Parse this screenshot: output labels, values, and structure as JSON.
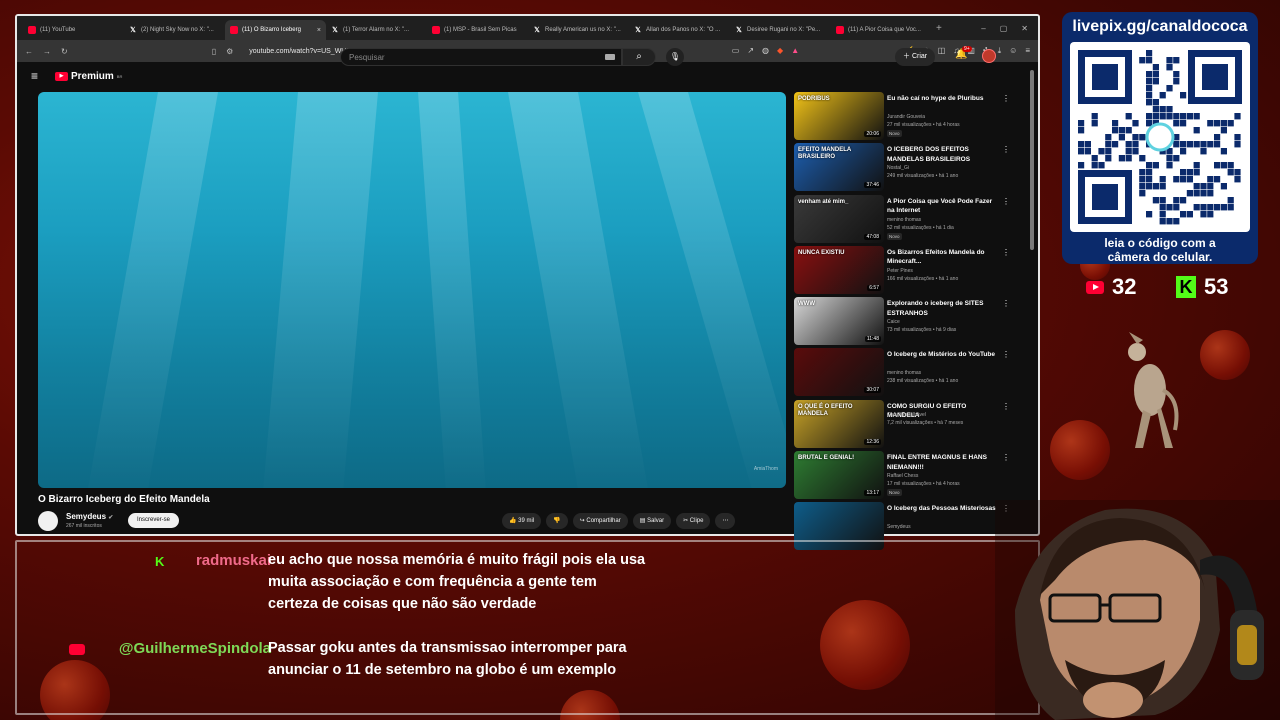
{
  "browser": {
    "tabs": [
      {
        "label": "(11) YouTube",
        "icon": "youtube-icon",
        "active": false
      },
      {
        "label": "(2) Night Sky Now no X: \"...",
        "icon": "x-icon",
        "active": false
      },
      {
        "label": "(11) O Bizarro Iceberg",
        "icon": "youtube-icon",
        "active": true
      },
      {
        "label": "(1) Terror Alarm no X: \"...",
        "icon": "x-icon",
        "active": false
      },
      {
        "label": "(1) MSP - Brasil Sem Picas",
        "icon": "youtube-icon",
        "active": false
      },
      {
        "label": "Really American us no X: \"...",
        "icon": "x-icon",
        "active": false
      },
      {
        "label": "Allan dos Panos no X: \"O ...",
        "icon": "x-icon",
        "active": false
      },
      {
        "label": "Desiree Rugani no X: \"Pe...",
        "icon": "x-icon",
        "active": false
      },
      {
        "label": "(11) A Pior Coisa que Voc...",
        "icon": "youtube-icon",
        "active": false
      }
    ],
    "url": "youtube.com/watch?v=US_WUEzBcOM"
  },
  "youtube": {
    "logo_text": "Premium",
    "logo_sup": "BR",
    "search_placeholder": "Pesquisar",
    "create_label": "Criar",
    "notif_count": "9+",
    "video": {
      "title": "O Bizarro Iceberg do Efeito Mandela",
      "channel": "Semydeus",
      "subscribers": "267 mil inscritos",
      "subscribe_label": "Inscrever-se",
      "likes": "39 mil",
      "share_label": "Compartilhar",
      "save_label": "Salvar",
      "clip_label": "Clipe",
      "watermark": "AmiaThom"
    },
    "recommendations": [
      {
        "title": "Eu não caí no hype de Pluribus",
        "channel": "Jurandir Gouveia",
        "meta": "27 mil visualizações • há 4 horas",
        "badge": "Novo",
        "duration": "20:06",
        "thumb_text": "PODRIBUS",
        "thumb_color": "#f2c318"
      },
      {
        "title": "O ICEBERG DOS EFEITOS MANDELAS BRASILEIROS",
        "channel": "Nostal_Gi",
        "meta": "249 mil visualizações • há 1 ano",
        "badge": "",
        "duration": "37:46",
        "thumb_text": "EFEITO MANDELA BRASILEIRO",
        "thumb_color": "#1d5fb0"
      },
      {
        "title": "A Pior Coisa que Você Pode Fazer na Internet",
        "channel": "menino thomas",
        "meta": "52 mil visualizações • há 1 dia",
        "badge": "Novo",
        "duration": "47:08",
        "thumb_text": "venham até mim_",
        "thumb_color": "#3a3a3a"
      },
      {
        "title": "Os Bizarros Efeitos Mandela do Minecraft...",
        "channel": "Peter Pines",
        "meta": "166 mil visualizações • há 1 ano",
        "badge": "",
        "duration": "6:57",
        "thumb_text": "NUNCA EXISTIU",
        "thumb_color": "#8a1010"
      },
      {
        "title": "Explorando o iceberg de SITES ESTRANHOS",
        "channel": "Caice",
        "meta": "73 mil visualizações • há 9 dias",
        "badge": "",
        "duration": "11:48",
        "thumb_text": "WWW",
        "thumb_color": "#d8d8d8"
      },
      {
        "title": "O Iceberg de Mistérios do YouTube",
        "channel": "menino thomas",
        "meta": "238 mil visualizações • há 1 ano",
        "badge": "",
        "duration": "30:07",
        "thumb_text": "",
        "thumb_color": "#5a0b0b"
      },
      {
        "title": "COMO SURGIU O EFEITO MANDELA",
        "channel": "Canal Espalhável",
        "meta": "7,2 mil visualizações • há 7 meses",
        "badge": "",
        "duration": "12:36",
        "thumb_text": "O QUE É O EFEITO MANDELA",
        "thumb_color": "#c7a227"
      },
      {
        "title": "FINAL ENTRE MAGNUS E HANS NIEMANN!!!",
        "channel": "Raffael Chess",
        "meta": "17 mil visualizações • há 4 horas",
        "badge": "Novo",
        "duration": "13:17",
        "thumb_text": "BRUTAL E GENIAL!",
        "thumb_color": "#2e7d32"
      },
      {
        "title": "O Iceberg das Pessoas Misteriosas",
        "channel": "Semydeus",
        "meta": "",
        "badge": "",
        "duration": "",
        "thumb_text": "",
        "thumb_color": "#0e5d8a"
      }
    ]
  },
  "overlay": {
    "qr_url": "livepix.gg/canaldococa",
    "qr_caption_1": "leia o código com a",
    "qr_caption_2": "câmera do celular.",
    "youtube_viewers": "32",
    "kick_viewers": "53"
  },
  "chat": [
    {
      "platform": "kick",
      "user": "radmuskai",
      "user_color": "#f06a8a",
      "text": "eu acho que nossa memória é muito frágil pois ela usa muita associação e com frequência a gente tem certeza de coisas que não são verdade"
    },
    {
      "platform": "youtube",
      "user": "@GuilhermeSpindola",
      "user_color": "#7ed957",
      "text": "Passar goku antes da transmissao interromper para anunciar o 11 de setembro na globo é um exemplo"
    }
  ]
}
